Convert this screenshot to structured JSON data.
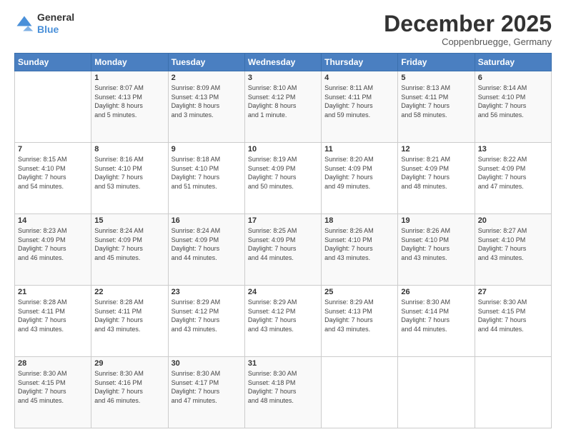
{
  "header": {
    "logo_line1": "General",
    "logo_line2": "Blue",
    "month": "December 2025",
    "location": "Coppenbruegge, Germany"
  },
  "weekdays": [
    "Sunday",
    "Monday",
    "Tuesday",
    "Wednesday",
    "Thursday",
    "Friday",
    "Saturday"
  ],
  "weeks": [
    [
      {
        "day": "",
        "info": ""
      },
      {
        "day": "1",
        "info": "Sunrise: 8:07 AM\nSunset: 4:13 PM\nDaylight: 8 hours\nand 5 minutes."
      },
      {
        "day": "2",
        "info": "Sunrise: 8:09 AM\nSunset: 4:13 PM\nDaylight: 8 hours\nand 3 minutes."
      },
      {
        "day": "3",
        "info": "Sunrise: 8:10 AM\nSunset: 4:12 PM\nDaylight: 8 hours\nand 1 minute."
      },
      {
        "day": "4",
        "info": "Sunrise: 8:11 AM\nSunset: 4:11 PM\nDaylight: 7 hours\nand 59 minutes."
      },
      {
        "day": "5",
        "info": "Sunrise: 8:13 AM\nSunset: 4:11 PM\nDaylight: 7 hours\nand 58 minutes."
      },
      {
        "day": "6",
        "info": "Sunrise: 8:14 AM\nSunset: 4:10 PM\nDaylight: 7 hours\nand 56 minutes."
      }
    ],
    [
      {
        "day": "7",
        "info": "Sunrise: 8:15 AM\nSunset: 4:10 PM\nDaylight: 7 hours\nand 54 minutes."
      },
      {
        "day": "8",
        "info": "Sunrise: 8:16 AM\nSunset: 4:10 PM\nDaylight: 7 hours\nand 53 minutes."
      },
      {
        "day": "9",
        "info": "Sunrise: 8:18 AM\nSunset: 4:10 PM\nDaylight: 7 hours\nand 51 minutes."
      },
      {
        "day": "10",
        "info": "Sunrise: 8:19 AM\nSunset: 4:09 PM\nDaylight: 7 hours\nand 50 minutes."
      },
      {
        "day": "11",
        "info": "Sunrise: 8:20 AM\nSunset: 4:09 PM\nDaylight: 7 hours\nand 49 minutes."
      },
      {
        "day": "12",
        "info": "Sunrise: 8:21 AM\nSunset: 4:09 PM\nDaylight: 7 hours\nand 48 minutes."
      },
      {
        "day": "13",
        "info": "Sunrise: 8:22 AM\nSunset: 4:09 PM\nDaylight: 7 hours\nand 47 minutes."
      }
    ],
    [
      {
        "day": "14",
        "info": "Sunrise: 8:23 AM\nSunset: 4:09 PM\nDaylight: 7 hours\nand 46 minutes."
      },
      {
        "day": "15",
        "info": "Sunrise: 8:24 AM\nSunset: 4:09 PM\nDaylight: 7 hours\nand 45 minutes."
      },
      {
        "day": "16",
        "info": "Sunrise: 8:24 AM\nSunset: 4:09 PM\nDaylight: 7 hours\nand 44 minutes."
      },
      {
        "day": "17",
        "info": "Sunrise: 8:25 AM\nSunset: 4:09 PM\nDaylight: 7 hours\nand 44 minutes."
      },
      {
        "day": "18",
        "info": "Sunrise: 8:26 AM\nSunset: 4:10 PM\nDaylight: 7 hours\nand 43 minutes."
      },
      {
        "day": "19",
        "info": "Sunrise: 8:26 AM\nSunset: 4:10 PM\nDaylight: 7 hours\nand 43 minutes."
      },
      {
        "day": "20",
        "info": "Sunrise: 8:27 AM\nSunset: 4:10 PM\nDaylight: 7 hours\nand 43 minutes."
      }
    ],
    [
      {
        "day": "21",
        "info": "Sunrise: 8:28 AM\nSunset: 4:11 PM\nDaylight: 7 hours\nand 43 minutes."
      },
      {
        "day": "22",
        "info": "Sunrise: 8:28 AM\nSunset: 4:11 PM\nDaylight: 7 hours\nand 43 minutes."
      },
      {
        "day": "23",
        "info": "Sunrise: 8:29 AM\nSunset: 4:12 PM\nDaylight: 7 hours\nand 43 minutes."
      },
      {
        "day": "24",
        "info": "Sunrise: 8:29 AM\nSunset: 4:12 PM\nDaylight: 7 hours\nand 43 minutes."
      },
      {
        "day": "25",
        "info": "Sunrise: 8:29 AM\nSunset: 4:13 PM\nDaylight: 7 hours\nand 43 minutes."
      },
      {
        "day": "26",
        "info": "Sunrise: 8:30 AM\nSunset: 4:14 PM\nDaylight: 7 hours\nand 44 minutes."
      },
      {
        "day": "27",
        "info": "Sunrise: 8:30 AM\nSunset: 4:15 PM\nDaylight: 7 hours\nand 44 minutes."
      }
    ],
    [
      {
        "day": "28",
        "info": "Sunrise: 8:30 AM\nSunset: 4:15 PM\nDaylight: 7 hours\nand 45 minutes."
      },
      {
        "day": "29",
        "info": "Sunrise: 8:30 AM\nSunset: 4:16 PM\nDaylight: 7 hours\nand 46 minutes."
      },
      {
        "day": "30",
        "info": "Sunrise: 8:30 AM\nSunset: 4:17 PM\nDaylight: 7 hours\nand 47 minutes."
      },
      {
        "day": "31",
        "info": "Sunrise: 8:30 AM\nSunset: 4:18 PM\nDaylight: 7 hours\nand 48 minutes."
      },
      {
        "day": "",
        "info": ""
      },
      {
        "day": "",
        "info": ""
      },
      {
        "day": "",
        "info": ""
      }
    ]
  ]
}
